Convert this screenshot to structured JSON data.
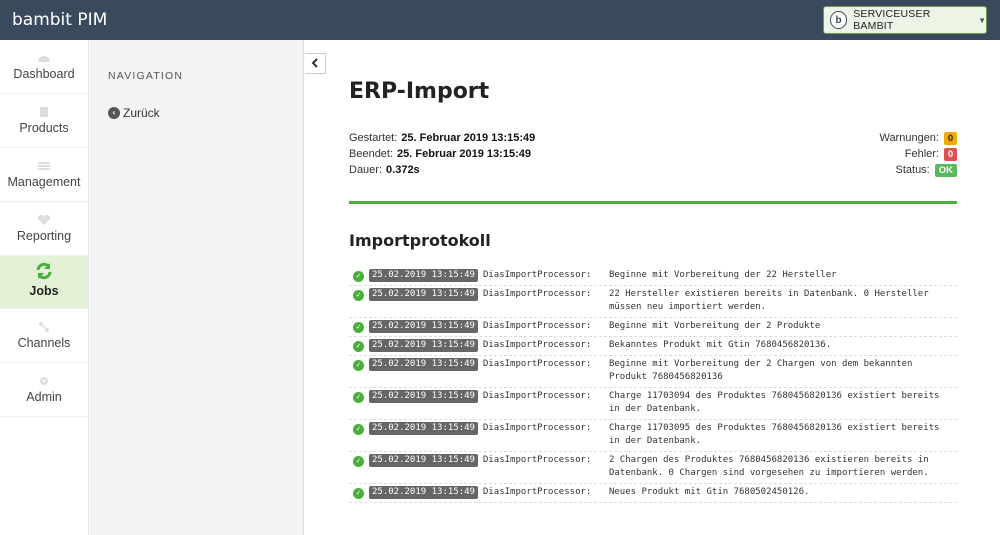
{
  "app": {
    "title": "bambit PIM"
  },
  "user": {
    "avatar": "b",
    "name": "SERVICEUSER BAMBIT",
    "caret": "▼"
  },
  "sidebar": {
    "items": [
      {
        "label": "Dashboard",
        "icon": "dashboard-icon"
      },
      {
        "label": "Products",
        "icon": "cube-icon"
      },
      {
        "label": "Management",
        "icon": "list-icon"
      },
      {
        "label": "Reporting",
        "icon": "heartbeat-icon"
      },
      {
        "label": "Jobs",
        "icon": "refresh-icon",
        "active": true
      },
      {
        "label": "Channels",
        "icon": "network-icon"
      },
      {
        "label": "Admin",
        "icon": "gears-icon"
      }
    ]
  },
  "subnav": {
    "title": "NAVIGATION",
    "back_label": "Zurück"
  },
  "page": {
    "title": "ERP-Import",
    "started_label": "Gestartet:",
    "started_value": "25. Februar 2019 13:15:49",
    "ended_label": "Beendet:",
    "ended_value": "25. Februar 2019 13:15:49",
    "duration_label": "Dauer:",
    "duration_value": "0.372s",
    "warnings_label": "Warnungen:",
    "warnings_value": "0",
    "errors_label": "Fehler:",
    "errors_value": "0",
    "status_label": "Status:",
    "status_value": "OK"
  },
  "log": {
    "title": "Importprotokoll",
    "entries": [
      {
        "ts": "25.02.2019 13:15:49",
        "src": "DiasImportProcessor:",
        "msg": "Beginne mit Vorbereitung der 22 Hersteller"
      },
      {
        "ts": "25.02.2019 13:15:49",
        "src": "DiasImportProcessor:",
        "msg": "22 Hersteller existieren bereits in Datenbank. 0 Hersteller müssen neu importiert werden."
      },
      {
        "ts": "25.02.2019 13:15:49",
        "src": "DiasImportProcessor:",
        "msg": "Beginne mit Vorbereitung der 2 Produkte"
      },
      {
        "ts": "25.02.2019 13:15:49",
        "src": "DiasImportProcessor:",
        "msg": "Bekanntes Produkt mit Gtin 7680456820136."
      },
      {
        "ts": "25.02.2019 13:15:49",
        "src": "DiasImportProcessor:",
        "msg": "Beginne mit Vorbereitung der 2 Chargen von dem bekannten Produkt 7680456820136"
      },
      {
        "ts": "25.02.2019 13:15:49",
        "src": "DiasImportProcessor:",
        "msg": "Charge 11703094 des Produktes 7680456820136 existiert bereits in der Datenbank."
      },
      {
        "ts": "25.02.2019 13:15:49",
        "src": "DiasImportProcessor:",
        "msg": "Charge 11703095 des Produktes 7680456820136 existiert bereits in der Datenbank."
      },
      {
        "ts": "25.02.2019 13:15:49",
        "src": "DiasImportProcessor:",
        "msg": "2 Chargen des Produktes 7680456820136 existieren bereits in Datenbank. 0 Chargen sind vorgesehen zu importieren werden."
      },
      {
        "ts": "25.02.2019 13:15:49",
        "src": "DiasImportProcessor:",
        "msg": "Neues Produkt mit Gtin 7680502450126."
      }
    ]
  }
}
